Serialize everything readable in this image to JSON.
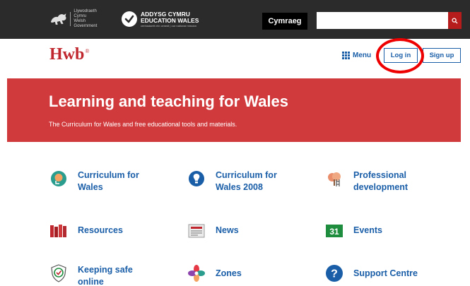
{
  "topbar": {
    "gov_logo_line1": "Llywodraeth Cymru",
    "gov_logo_line2": "Welsh Government",
    "ew_logo_line1": "ADDYSG CYMRU",
    "ew_logo_line2": "EDUCATION WALES",
    "ew_logo_tagline": "cenhadaeth ein cenedl | our national mission",
    "language_button": "Cymraeg",
    "search": {
      "value": "",
      "placeholder": ""
    }
  },
  "header": {
    "logo": "Hwb",
    "logo_mark": "®",
    "menu_label": "Menu",
    "login_label": "Log in",
    "signup_label": "Sign up"
  },
  "hero": {
    "title": "Learning and teaching for Wales",
    "subtitle": "The Curriculum for Wales and free educational tools and materials."
  },
  "tiles": [
    {
      "label": "Curriculum for Wales",
      "icon": "curriculum-head-icon"
    },
    {
      "label": "Curriculum for Wales 2008",
      "icon": "lightbulb-icon"
    },
    {
      "label": "Professional development",
      "icon": "tree-ladder-icon"
    },
    {
      "label": "Resources",
      "icon": "books-icon"
    },
    {
      "label": "News",
      "icon": "newspaper-icon"
    },
    {
      "label": "Events",
      "icon": "calendar-icon",
      "icon_text": "31"
    },
    {
      "label": "Keeping safe online",
      "icon": "shield-badge-icon"
    },
    {
      "label": "Zones",
      "icon": "pinwheel-icon"
    },
    {
      "label": "Support Centre",
      "icon": "help-icon",
      "icon_text": "?"
    }
  ],
  "colors": {
    "brand_red": "#d13a3d",
    "logo_red": "#c0262d",
    "link_blue": "#1a5ea8",
    "topbar": "#2b2b2b",
    "highlight": "#ee0000"
  }
}
